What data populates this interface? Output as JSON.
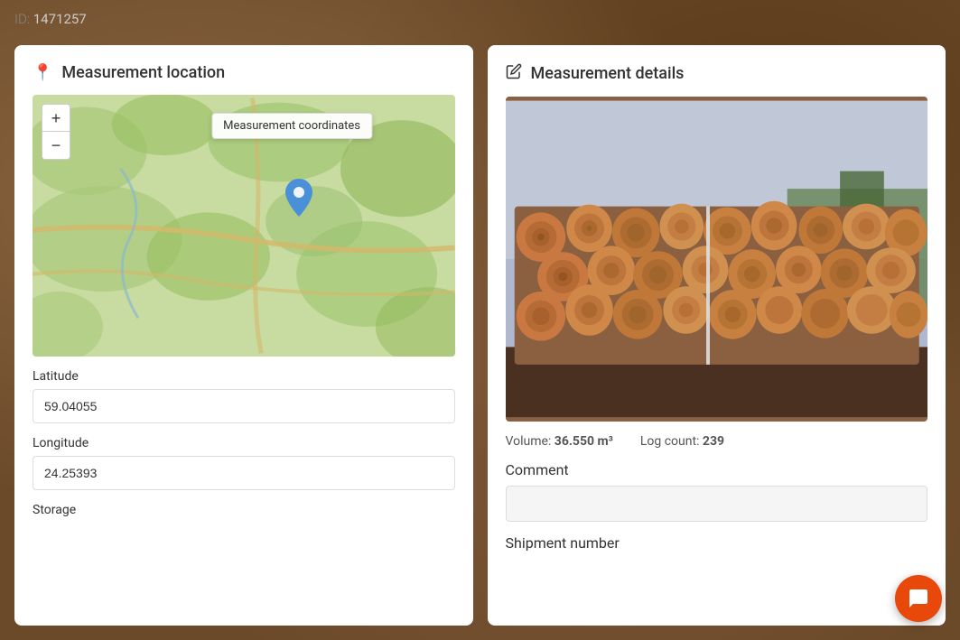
{
  "page": {
    "id_label": "ID:",
    "id_value": "1471257"
  },
  "left_panel": {
    "title": "Measurement location",
    "icon": "📍",
    "map_tooltip": "Measurement coordinates",
    "zoom_in": "+",
    "zoom_out": "−",
    "latitude_label": "Latitude",
    "latitude_value": "59.04055",
    "longitude_label": "Longitude",
    "longitude_value": "24.25393",
    "storage_label": "Storage"
  },
  "right_panel": {
    "title": "Measurement details",
    "icon": "✎",
    "volume_label": "Volume:",
    "volume_value": "36.550 m³",
    "log_count_label": "Log count:",
    "log_count_value": "239",
    "comment_label": "Comment",
    "comment_placeholder": "",
    "shipment_label": "Shipment number"
  }
}
